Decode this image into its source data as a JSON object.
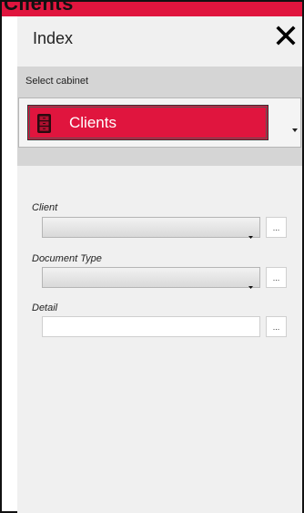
{
  "window": {
    "title": "Clients"
  },
  "header": {
    "title": "Index",
    "close_icon": "close-icon"
  },
  "cabinet": {
    "label": "Select cabinet",
    "selected": "Clients",
    "icon": "cabinet-icon",
    "accent_color": "#e0153e"
  },
  "fields": [
    {
      "label": "Client",
      "type": "combo",
      "value": "",
      "button_label": "..."
    },
    {
      "label": "Document Type",
      "type": "combo",
      "value": "",
      "button_label": "..."
    },
    {
      "label": "Detail",
      "type": "text",
      "value": "",
      "button_label": "..."
    }
  ]
}
